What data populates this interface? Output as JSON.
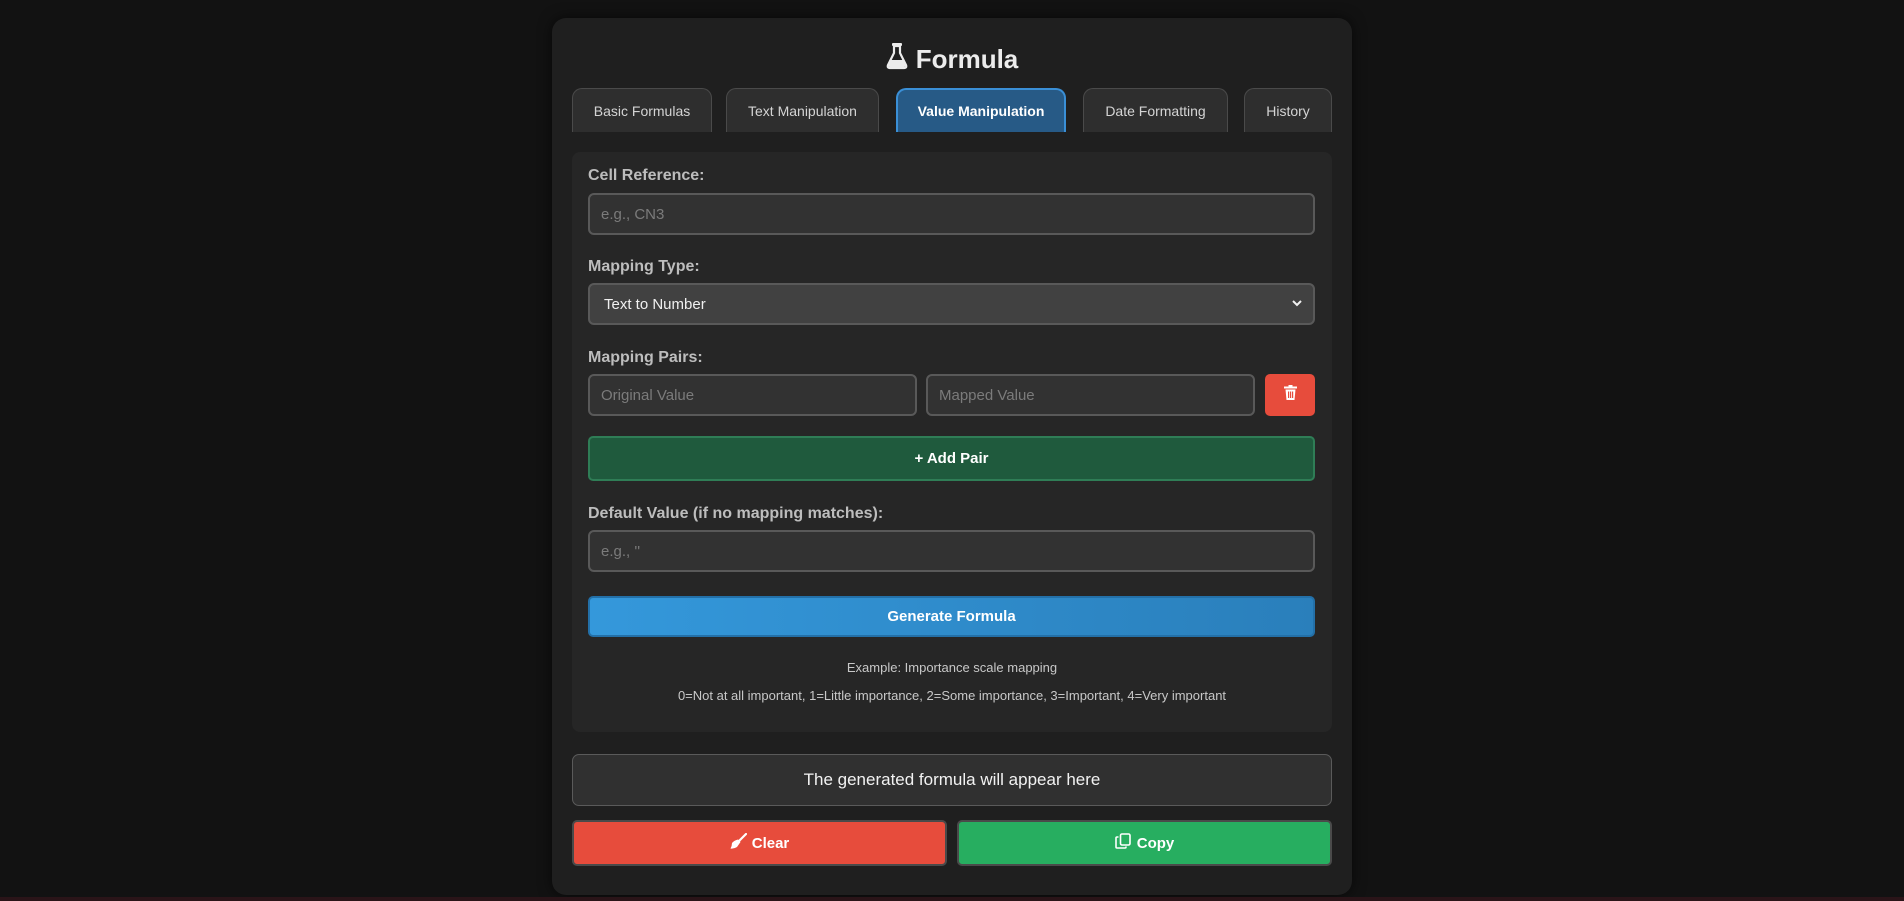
{
  "header": {
    "title": "Formula",
    "icon": "flask-icon"
  },
  "tabs": [
    {
      "label": "Basic Formulas",
      "active": false
    },
    {
      "label": "Text Manipulation",
      "active": false
    },
    {
      "label": "Value Manipulation",
      "active": true
    },
    {
      "label": "Date Formatting",
      "active": false
    },
    {
      "label": "History",
      "active": false
    }
  ],
  "form": {
    "cell_reference": {
      "label": "Cell Reference:",
      "value": "",
      "placeholder": "e.g., CN3"
    },
    "mapping_type": {
      "label": "Mapping Type:",
      "selected": "Text to Number"
    },
    "mapping_pairs": {
      "label": "Mapping Pairs:",
      "original_placeholder": "Original Value",
      "mapped_placeholder": "Mapped Value",
      "delete_icon": "trash-icon"
    },
    "add_pair_label": "+ Add Pair",
    "default_value": {
      "label": "Default Value (if no mapping matches):",
      "value": "",
      "placeholder": "e.g., ''"
    },
    "generate_label": "Generate Formula",
    "example_title": "Example: Importance scale mapping",
    "example_body": "0=Not at all important, 1=Little importance, 2=Some importance, 3=Important, 4=Very important"
  },
  "output": {
    "placeholder": "The generated formula will appear here"
  },
  "actions": {
    "clear_label": "Clear",
    "clear_icon": "broom-icon",
    "copy_label": "Copy",
    "copy_icon": "copy-icon"
  },
  "colors": {
    "accent_blue": "#3498db",
    "danger_red": "#e74c3c",
    "success_green": "#27ae60",
    "add_green": "#1f5a3d",
    "background": "#121212",
    "panel": "#1f1f1f"
  }
}
